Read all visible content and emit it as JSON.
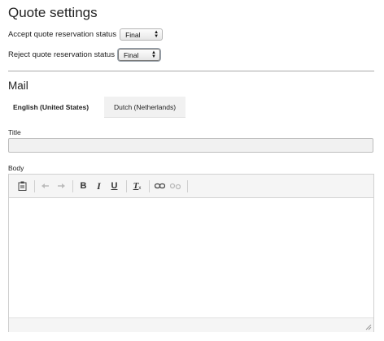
{
  "quote_settings": {
    "heading": "Quote settings",
    "accept_label": "Accept quote reservation status",
    "accept_value": "Final",
    "reject_label": "Reject quote reservation status",
    "reject_value": "Final"
  },
  "mail": {
    "heading": "Mail",
    "tabs": [
      {
        "label": "English (United States)",
        "active": true
      },
      {
        "label": "Dutch (Netherlands)",
        "active": false
      }
    ],
    "title_label": "Title",
    "title_value": "",
    "body_label": "Body",
    "toolbar": {
      "buttons": [
        "paste-text-icon",
        "undo-icon",
        "redo-icon",
        "bold-icon",
        "italic-icon",
        "underline-icon",
        "remove-format-icon",
        "link-icon",
        "unlink-icon"
      ],
      "bold": "B",
      "italic": "I",
      "underline": "U",
      "remove_format": "T"
    }
  }
}
